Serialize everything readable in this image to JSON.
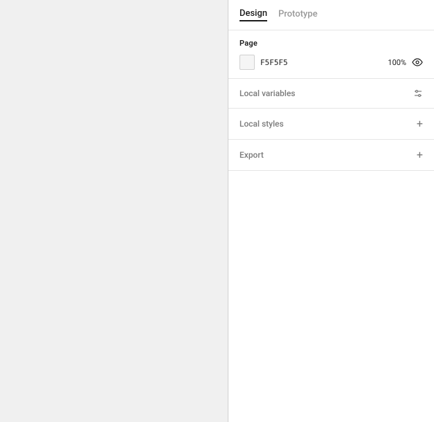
{
  "canvas": {
    "bg_color": "#f0f0f0"
  },
  "panel": {
    "tabs": [
      {
        "id": "design",
        "label": "Design",
        "active": true
      },
      {
        "id": "prototype",
        "label": "Prototype",
        "active": false
      }
    ],
    "page_section": {
      "title": "Page",
      "color_value": "F5F5F5",
      "opacity": "100%"
    },
    "local_variables": {
      "label": "Local variables"
    },
    "local_styles": {
      "label": "Local styles"
    },
    "export": {
      "label": "Export"
    }
  }
}
